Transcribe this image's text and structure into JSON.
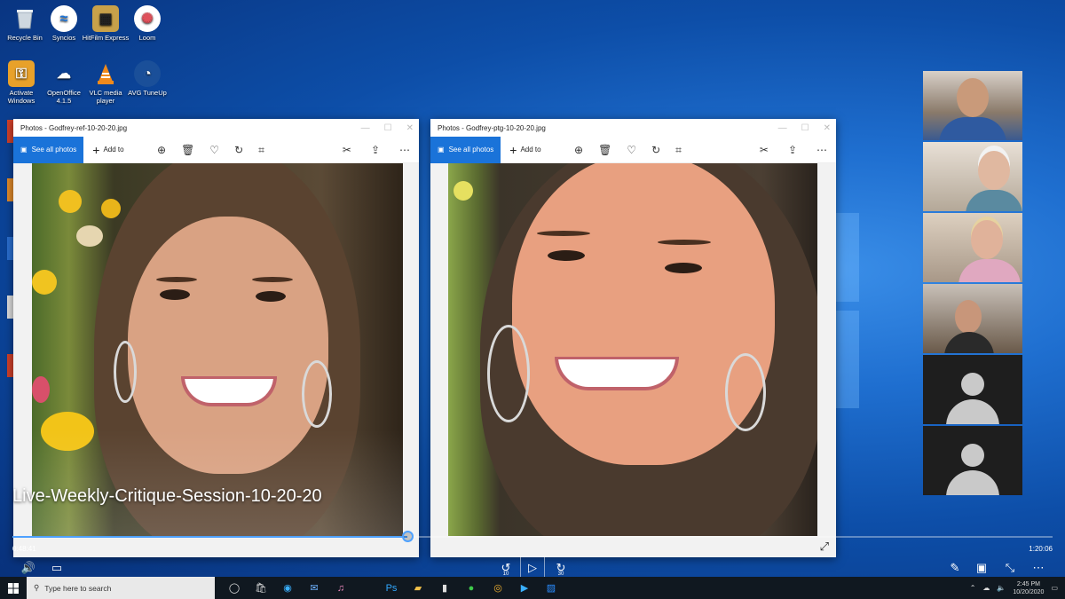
{
  "desktop": {
    "icons": [
      {
        "label": "Recycle Bin",
        "icon": "recycle-bin-icon"
      },
      {
        "label": "Syncios",
        "icon": "syncios-icon"
      },
      {
        "label": "HitFilm Express",
        "icon": "hitfilm-icon"
      },
      {
        "label": "Loom",
        "icon": "loom-icon"
      },
      {
        "label": "Activate Windows",
        "icon": "activate-windows-icon"
      },
      {
        "label": "OpenOffice 4.1.5",
        "icon": "openoffice-icon"
      },
      {
        "label": "VLC media player",
        "icon": "vlc-icon"
      },
      {
        "label": "AVG TuneUp",
        "icon": "avg-tuneup-icon"
      }
    ]
  },
  "windows": [
    {
      "title": "Photos - Godfrey-ref-10-20-20.jpg",
      "see_all": "See all photos",
      "add_to": "Add to"
    },
    {
      "title": "Photos - Godfrey-ptg-10-20-20.jpg",
      "see_all": "See all photos",
      "add_to": "Add to"
    }
  ],
  "video": {
    "title": "Live-Weekly-Critique-Session-10-20-20",
    "elapsed": "0:48:41",
    "duration": "1:20:06",
    "progress": 0.38,
    "skip_back": "10",
    "skip_forward": "30"
  },
  "taskbar": {
    "search_placeholder": "Type here to search",
    "time": "2:45 PM",
    "date": "10/20/2020"
  },
  "colors": {
    "accent": "#1a73d9",
    "taskbar": "#101820",
    "progress": "#4ea1ff"
  }
}
